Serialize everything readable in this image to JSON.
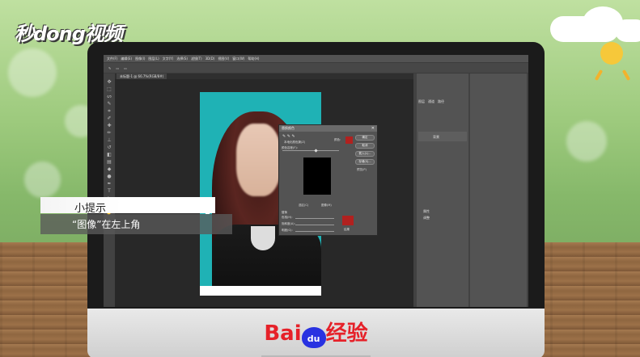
{
  "watermark": {
    "brand": "秒dong视频"
  },
  "menubar": [
    "文件(F)",
    "编辑(E)",
    "图像(I)",
    "图层(L)",
    "文字(Y)",
    "选择(S)",
    "滤镜(T)",
    "3D(D)",
    "视图(V)",
    "窗口(W)",
    "帮助(H)"
  ],
  "document_tab": "未标题-1 @ 66.7%(RGB/8#)",
  "dialog": {
    "title": "替换颜色",
    "localized_color_clusters": "本地化颜色簇(Z)",
    "fuzziness_label": "颜色容差(F):",
    "color_label": "颜色:",
    "selection_option": "选区(C)",
    "image_option": "图像(M)",
    "replace_section": "替换",
    "hue_label": "色相(H):",
    "saturation_label": "饱和度(A):",
    "lightness_label": "明度(G):",
    "result_label": "结果",
    "ok": "确定",
    "cancel": "取消",
    "load": "载入(L)...",
    "save": "存储(S)...",
    "preview": "预览(P)"
  },
  "panels": {
    "layers_tab": "图层",
    "channels_tab": "通道",
    "paths_tab": "路径",
    "layer_name": "背景",
    "properties": "属性",
    "adjustments": "调整"
  },
  "tip": {
    "title": "小提示",
    "body": "“图像”在左上角"
  },
  "footer": {
    "brand_red": "Bai",
    "brand_paw": "du",
    "brand_cn": "经验"
  },
  "colors": {
    "swatch": "#b1211f",
    "photo_bg": "#1fb2b5",
    "baidu_red": "#e62129",
    "baidu_blue": "#2932e1"
  }
}
